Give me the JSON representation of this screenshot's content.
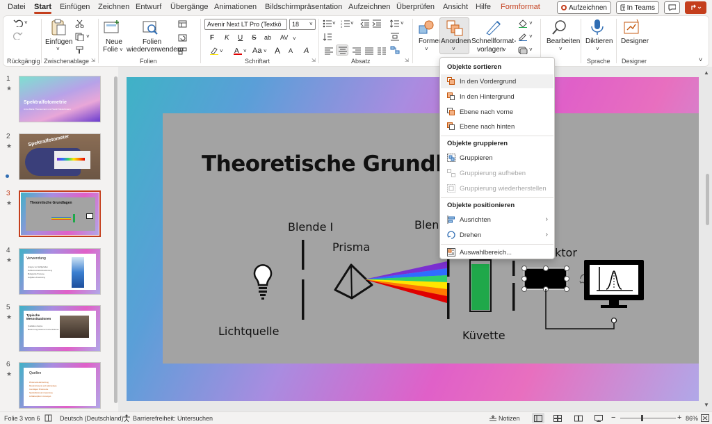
{
  "menu": {
    "tabs": [
      "Datei",
      "Start",
      "Einfügen",
      "Zeichnen",
      "Entwurf",
      "Übergänge",
      "Animationen",
      "Bildschirmpräsentation",
      "Aufzeichnen",
      "Überprüfen",
      "Ansicht",
      "Hilfe",
      "Formformat"
    ],
    "active_tab": "Start",
    "record_button": "Aufzeichnen",
    "teams_button": "In Teams"
  },
  "ribbon": {
    "undo_group": "Rückgängig",
    "clipboard": {
      "paste": "Einfügen",
      "group": "Zwischenablage"
    },
    "slides": {
      "new_slide_1": "Neue",
      "new_slide_2": "Folie",
      "reuse_1": "Folien",
      "reuse_2": "wiederverwenden",
      "group": "Folien"
    },
    "font": {
      "family": "Avenir Next LT Pro (Textkö",
      "size": "18",
      "bold": "F",
      "italic": "K",
      "underline": "U",
      "strike": "S",
      "shadow": "ab",
      "spacing": "AV",
      "case": "Aa",
      "grow": "A",
      "shrink": "A",
      "clear": "A",
      "group": "Schriftart"
    },
    "paragraph": {
      "group": "Absatz"
    },
    "drawing": {
      "shapes": "Formen",
      "arrange": "Anordnen",
      "quick_styles_1": "Schnellformat-",
      "quick_styles_2": "vorlagen"
    },
    "editing": {
      "label": "Bearbeiten"
    },
    "voice": {
      "label": "Diktieren",
      "group": "Sprache"
    },
    "designer": {
      "label": "Designer",
      "group": "Designer"
    }
  },
  "thumbnails": [
    {
      "num": "1",
      "title": "Spektralfotometrie",
      "subtitle": "Anna Maria Thomasmann und Sarah Mietschmann"
    },
    {
      "num": "2",
      "title": "Spektralfotometer"
    },
    {
      "num": "3",
      "title": "Theoretische Grundlagen"
    },
    {
      "num": "4",
      "title": "Verwendung",
      "lines": [
        "Analyse von Stoffgehalten",
        "Stoffkonzentrationsbestimmung",
        "Biologische Prozesse",
        "Aufgaben-Anwendung"
      ]
    },
    {
      "num": "5",
      "title": "Typische Messsituationen",
      "lines": [
        "Qualitative Analyse",
        "Bestimmung bekannter Konzentrationen"
      ]
    },
    {
      "num": "6",
      "title": "Quellen",
      "lines": [
        "Photometrie-Einfuehrung",
        "Messinstrumente und Laboranalyse",
        "Grundlagen Photometrie",
        "Spektralfotometer Anwendung",
        "Lichtabsorption in Lösungen"
      ]
    }
  ],
  "slide": {
    "title": "Theoretische Grundla",
    "labels": {
      "lamp": "Lichtquelle",
      "slit1": "Blende I",
      "prism": "Prisma",
      "slit2": "Blen",
      "cuvette": "Küvette",
      "detector": "ktor"
    }
  },
  "dropdown": {
    "sections": [
      {
        "header": "Objekte sortieren",
        "items": [
          {
            "label": "In den Vordergrund",
            "icon": "bring-to-front-icon",
            "disabled": false,
            "hover": true
          },
          {
            "label": "In den Hintergrund",
            "icon": "send-to-back-icon",
            "disabled": false
          },
          {
            "label": "Ebene nach vorne",
            "icon": "bring-forward-icon",
            "disabled": false
          },
          {
            "label": "Ebene nach hinten",
            "icon": "send-backward-icon",
            "disabled": false
          }
        ]
      },
      {
        "header": "Objekte gruppieren",
        "items": [
          {
            "label": "Gruppieren",
            "icon": "group-icon",
            "disabled": false
          },
          {
            "label": "Gruppierung aufheben",
            "icon": "ungroup-icon",
            "disabled": true
          },
          {
            "label": "Gruppierung wiederherstellen",
            "icon": "regroup-icon",
            "disabled": true
          }
        ]
      },
      {
        "header": "Objekte positionieren",
        "items": [
          {
            "label": "Ausrichten",
            "icon": "align-icon",
            "disabled": false,
            "submenu": true
          },
          {
            "label": "Drehen",
            "icon": "rotate-icon",
            "disabled": false,
            "submenu": true
          }
        ]
      }
    ],
    "footer_item": "Auswahlbereich..."
  },
  "status": {
    "slide_info": "Folie 3 von 6",
    "language": "Deutsch (Deutschland)",
    "accessibility": "Barrierefreiheit: Untersuchen",
    "notes": "Notizen",
    "zoom": "86%"
  },
  "colors": {
    "accent": "#c43e1c",
    "cuvette": "#1fa84a"
  }
}
